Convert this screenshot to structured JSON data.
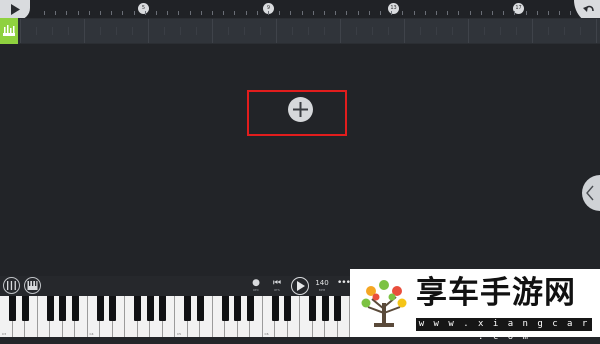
{
  "timeline": {
    "play_icon": "play-icon",
    "corner_icon": "undo-arrow-icon",
    "bar_markers": [
      {
        "label": "5"
      },
      {
        "label": "9"
      },
      {
        "label": "13"
      },
      {
        "label": "17"
      }
    ]
  },
  "track": {
    "icon": "drum-pads-icon",
    "accent_color": "#8fd13f"
  },
  "arrangement": {
    "add_button_icon": "plus-icon",
    "highlight_color": "#e21d1d",
    "side_panel_icon": "chevron-left-icon"
  },
  "controls": {
    "mixer_icon": "mixer-icon",
    "piano_icon": "piano-icon",
    "record_label": "REC",
    "restart_label": "RTS",
    "tempo_value": "140",
    "tempo_label": "BPM",
    "more_label": "MORE"
  },
  "keyboard": {
    "octave_labels": [
      "C3",
      "C4",
      "C5",
      "C6"
    ]
  },
  "watermark": {
    "title": "享车手游网",
    "url": "w w w . x i a n g c a r . c o m"
  }
}
